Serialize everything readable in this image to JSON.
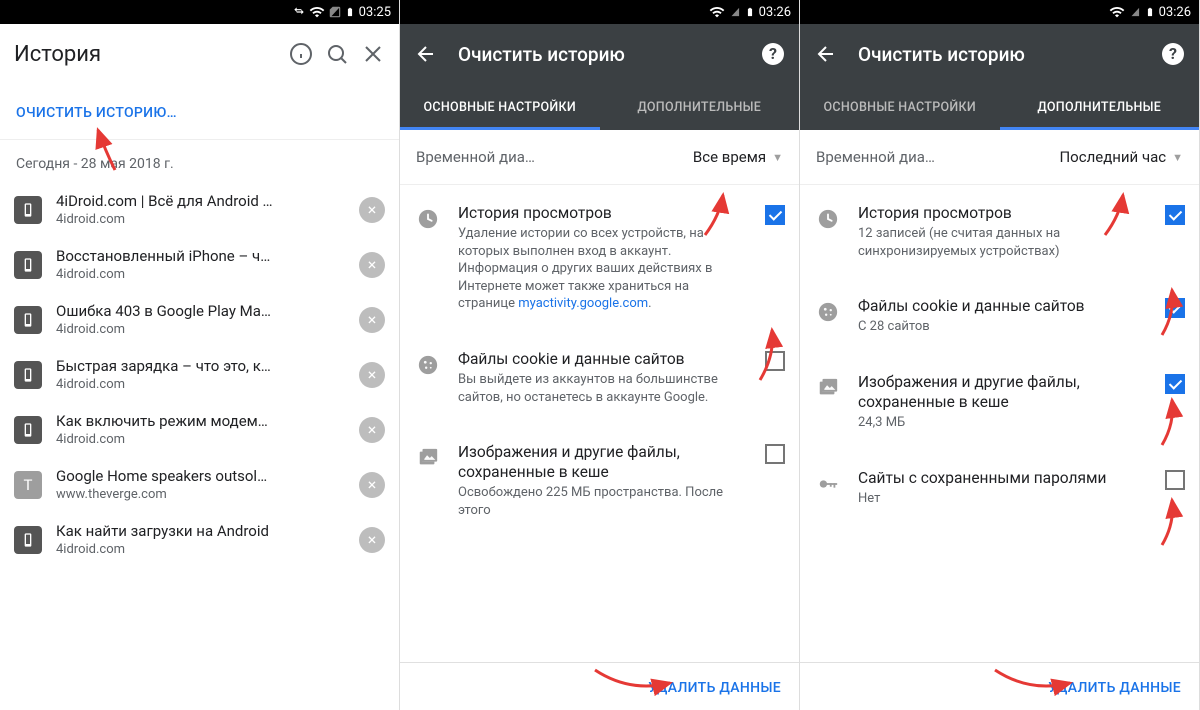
{
  "status_time_1": "03:25",
  "status_time_2": "03:26",
  "status_time_3": "03:26",
  "screen1": {
    "title": "История",
    "clear_link": "ОЧИСТИТЬ ИСТОРИЮ…",
    "date_heading": "Сегодня - 28 мая 2018 г.",
    "items": [
      {
        "title": "4iDroid.com | Всё для Android …",
        "domain": "4idroid.com",
        "icon": "phone"
      },
      {
        "title": "Восстановленный iPhone – ч…",
        "domain": "4idroid.com",
        "icon": "phone"
      },
      {
        "title": "Ошибка 403 в Google Play Ma…",
        "domain": "4idroid.com",
        "icon": "phone"
      },
      {
        "title": "Быстрая зарядка – что это, к…",
        "domain": "4idroid.com",
        "icon": "phone"
      },
      {
        "title": "Как включить режим модем…",
        "domain": "4idroid.com",
        "icon": "phone"
      },
      {
        "title": "Google Home speakers outsol…",
        "domain": "www.theverge.com",
        "icon": "T"
      },
      {
        "title": "Как найти загрузки на Android",
        "domain": "4idroid.com",
        "icon": "phone"
      }
    ]
  },
  "screen2": {
    "title": "Очистить историю",
    "tab_basic": "ОСНОВНЫЕ НАСТРОЙКИ",
    "tab_adv": "ДОПОЛНИТЕЛЬНЫЕ",
    "time_label": "Временной диа…",
    "time_value": "Все время",
    "items": [
      {
        "title": "История просмотров",
        "sub1": "Удаление истории со всех устройств, на которых выполнен вход в аккаунт. Информация о других ваших действиях в Интернете может также храниться на странице ",
        "link": "myactivity.google.com",
        "sub2": ".",
        "checked": true
      },
      {
        "title": "Файлы cookie и данные сайтов",
        "sub1": "Вы выйдете из аккаунтов на большинстве сайтов, но останетесь в аккаунте Google.",
        "checked": false
      },
      {
        "title": "Изображения и другие файлы, сохраненные в кеше",
        "sub1": "Освобождено 225 МБ пространства. После этого",
        "checked": false
      }
    ],
    "delete_btn": "УДАЛИТЬ ДАННЫЕ"
  },
  "screen3": {
    "title": "Очистить историю",
    "tab_basic": "ОСНОВНЫЕ НАСТРОЙКИ",
    "tab_adv": "ДОПОЛНИТЕЛЬНЫЕ",
    "time_label": "Временной диа…",
    "time_value": "Последний час",
    "items": [
      {
        "title": "История просмотров",
        "sub1": "12 записей (не считая данных на синхронизируемых устройствах)",
        "checked": true
      },
      {
        "title": "Файлы cookie и данные сайтов",
        "sub1": "С 28 сайтов",
        "checked": true
      },
      {
        "title": "Изображения и другие файлы, сохраненные в кеше",
        "sub1": "24,3 МБ",
        "checked": true
      },
      {
        "title": "Сайты с сохраненными паролями",
        "sub1": "Нет",
        "checked": false
      }
    ],
    "delete_btn": "УДАЛИТЬ ДАННЫЕ"
  }
}
